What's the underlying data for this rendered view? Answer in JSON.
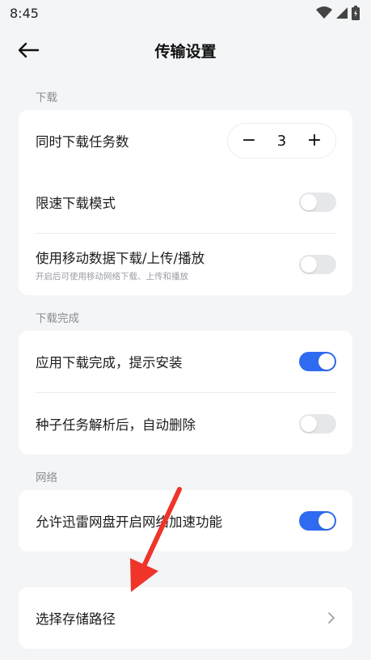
{
  "status": {
    "time": "8:45"
  },
  "header": {
    "title": "传输设置"
  },
  "sections": {
    "download": {
      "label": "下载",
      "concurrent_label": "同时下载任务数",
      "concurrent_value": "3",
      "minus": "−",
      "plus": "+",
      "speed_limit_label": "限速下载模式",
      "speed_limit_on": false,
      "mobile_data_label": "使用移动数据下载/上传/播放",
      "mobile_data_sub": "开启后可使用移动网络下载、上传和播放",
      "mobile_data_on": false
    },
    "complete": {
      "label": "下载完成",
      "install_prompt_label": "应用下载完成，提示安装",
      "install_prompt_on": true,
      "auto_delete_label": "种子任务解析后，自动删除",
      "auto_delete_on": false
    },
    "network": {
      "label": "网络",
      "accelerate_label": "允许迅雷网盘开启网络加速功能",
      "accelerate_on": true
    },
    "storage": {
      "path_label": "选择存储路径"
    }
  },
  "colors": {
    "accent": "#2f6bf0",
    "annotation_arrow": "#f0342a"
  }
}
